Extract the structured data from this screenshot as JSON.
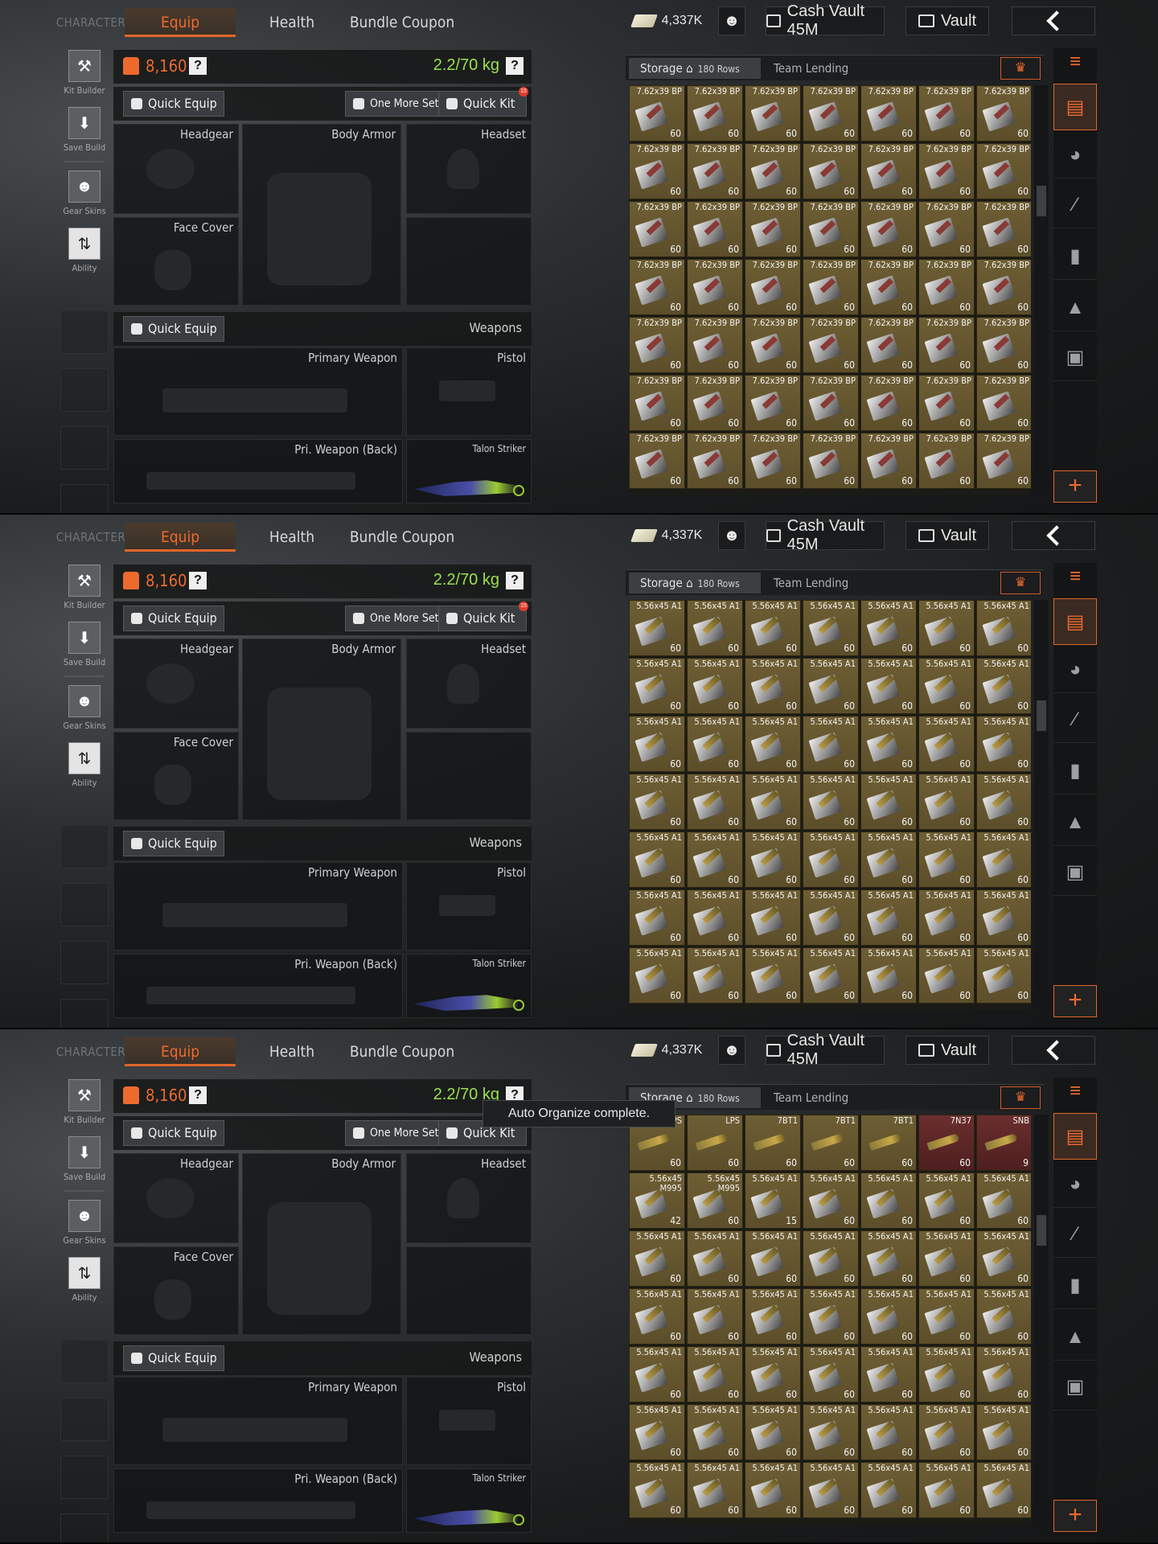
{
  "tabs": {
    "character": "CHARACTER",
    "equip": "Equip",
    "health": "Health",
    "bundle": "Bundle Coupon"
  },
  "top": {
    "cash": "4,337K",
    "cash_vault": "Cash Vault 45M",
    "vault": "Vault"
  },
  "rail": {
    "kit_builder": "Kit Builder",
    "save_build": "Save Build",
    "gear_skins": "Gear Skins",
    "ability": "Ability"
  },
  "gear": {
    "money": "8,160",
    "help": "?",
    "weight": "2.2/70 kg",
    "quick_equip": "Quick Equip",
    "one_more_set": "One More Set",
    "quick_kit": "Quick Kit",
    "quick_kit_badge": "15",
    "headgear": "Headgear",
    "body_armor": "Body Armor",
    "headset": "Headset",
    "face_cover": "Face Cover",
    "weapons": "Weapons",
    "primary_weapon": "Primary Weapon",
    "pistol": "Pistol",
    "pri_weapon_back": "Pri. Weapon (Back)",
    "melee": "Talon Striker"
  },
  "storage": {
    "tab": "Storage",
    "rows": "180 Rows",
    "team_lending": "Team Lending"
  },
  "toast": "Auto Organize complete.",
  "colors": {
    "accent": "#e2662b",
    "weight_ok": "#9be04e",
    "item_cell": "#6e5e34"
  },
  "panels": [
    {
      "rows": [
        [
          "7.62x39 BP",
          "60"
        ],
        [
          "7.62x39 BP",
          "60"
        ],
        [
          "7.62x39 BP",
          "60"
        ],
        [
          "7.62x39 BP",
          "60"
        ],
        [
          "7.62x39 BP",
          "60"
        ],
        [
          "7.62x39 BP",
          "60"
        ],
        [
          "7.62x39 BP",
          "60"
        ]
      ],
      "row_types": [
        "bp",
        "bp",
        "bp",
        "bp",
        "bp",
        "bp",
        "bp"
      ]
    },
    {
      "rows": [
        [
          "5.56x45 A1",
          "60"
        ],
        [
          "5.56x45 A1",
          "60"
        ],
        [
          "5.56x45 A1",
          "60"
        ],
        [
          "5.56x45 A1",
          "60"
        ],
        [
          "5.56x45 A1",
          "60"
        ],
        [
          "5.56x45 A1",
          "60"
        ],
        [
          "5.56x45 A1",
          "60"
        ]
      ]
    },
    {
      "first_row": [
        [
          "PS",
          "60"
        ],
        [
          "LPS",
          "60"
        ],
        [
          "7BT1",
          "60"
        ],
        [
          "7BT1",
          "60"
        ],
        [
          "7BT1",
          "60"
        ],
        [
          "7N37",
          "60"
        ],
        [
          "SNB",
          "9"
        ]
      ],
      "second_row": [
        [
          "5.56x45 M995",
          "42"
        ],
        [
          "5.56x45 M995",
          "60"
        ],
        [
          "5.56x45 A1",
          "15"
        ],
        [
          "5.56x45 A1",
          "60"
        ],
        [
          "5.56x45 A1",
          "60"
        ],
        [
          "5.56x45 A1",
          "60"
        ],
        [
          "5.56x45 A1",
          "60"
        ]
      ],
      "rows": [
        [
          "5.56x45 A1",
          "60"
        ],
        [
          "5.56x45 A1",
          "60"
        ],
        [
          "5.56x45 A1",
          "60"
        ],
        [
          "5.56x45 A1",
          "60"
        ],
        [
          "5.56x45 A1",
          "60"
        ]
      ]
    }
  ]
}
